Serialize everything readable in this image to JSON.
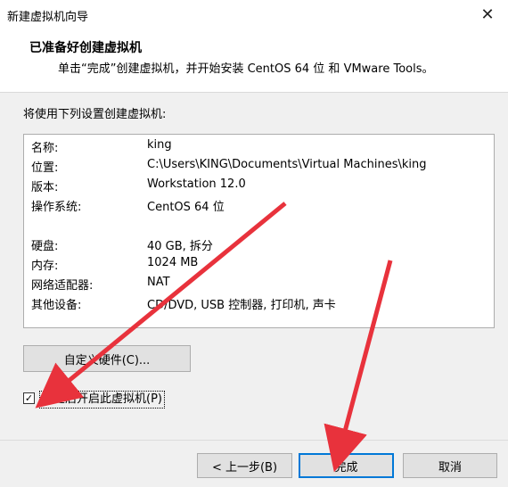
{
  "window": {
    "title": "新建虚拟机向导",
    "close_glyph": "✕"
  },
  "header": {
    "title": "已准备好创建虚拟机",
    "subtitle": "单击“完成”创建虚拟机，并开始安装 CentOS 64 位 和 VMware Tools。"
  },
  "section_label": "将使用下列设置创建虚拟机:",
  "summary": [
    {
      "key": "名称:",
      "value": "king"
    },
    {
      "key": "位置:",
      "value": "C:\\Users\\KING\\Documents\\Virtual Machines\\king"
    },
    {
      "key": "版本:",
      "value": "Workstation 12.0"
    },
    {
      "key": "操作系统:",
      "value": "CentOS 64 位"
    },
    {
      "key": "硬盘:",
      "value": "40 GB, 拆分"
    },
    {
      "key": "内存:",
      "value": "1024 MB"
    },
    {
      "key": "网络适配器:",
      "value": "NAT"
    },
    {
      "key": "其他设备:",
      "value": "CD/DVD, USB 控制器, 打印机, 声卡"
    }
  ],
  "buttons": {
    "customize": "自定义硬件(C)...",
    "back": "< 上一步(B)",
    "finish": "完成",
    "cancel": "取消"
  },
  "checkbox": {
    "label": "创建后开启此虚拟机(P)",
    "checked": true,
    "check_glyph": "✓"
  },
  "annotations": {
    "arrow_color": "#e8323c"
  }
}
